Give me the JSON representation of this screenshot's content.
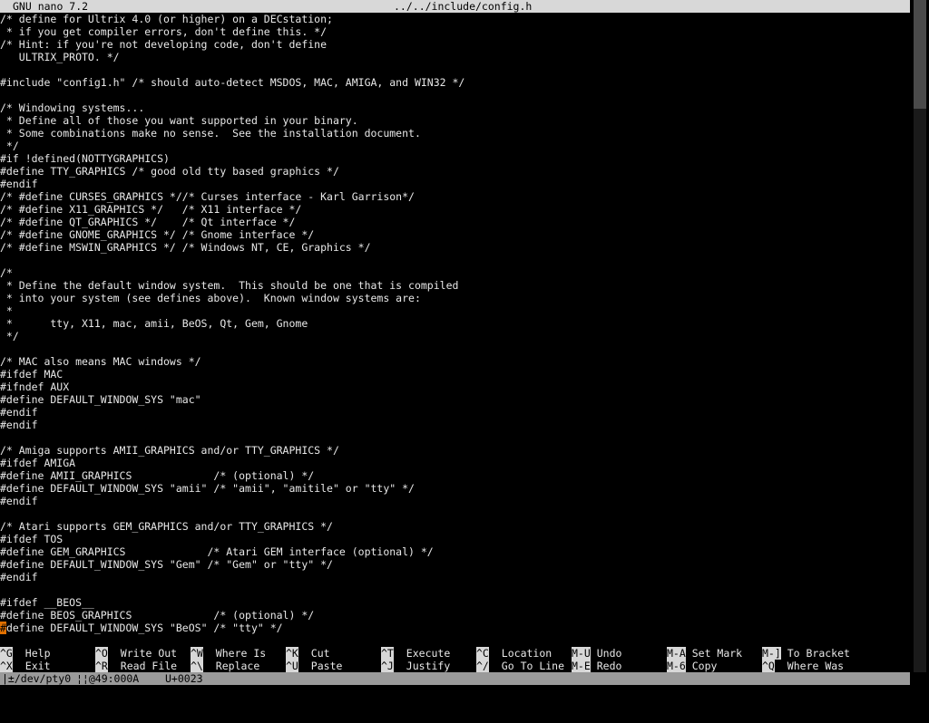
{
  "titlebar": {
    "app": "GNU nano 7.2",
    "file": "../../include/config.h"
  },
  "editor": {
    "lines": [
      "/* define for Ultrix 4.0 (or higher) on a DECstation;",
      " * if you get compiler errors, don't define this. */",
      "/* Hint: if you're not developing code, don't define",
      "   ULTRIX_PROTO. */",
      "",
      "#include \"config1.h\" /* should auto-detect MSDOS, MAC, AMIGA, and WIN32 */",
      "",
      "/* Windowing systems...",
      " * Define all of those you want supported in your binary.",
      " * Some combinations make no sense.  See the installation document.",
      " */",
      "#if !defined(NOTTYGRAPHICS)",
      "#define TTY_GRAPHICS /* good old tty based graphics */",
      "#endif",
      "/* #define CURSES_GRAPHICS *//* Curses interface - Karl Garrison*/",
      "/* #define X11_GRAPHICS */   /* X11 interface */",
      "/* #define QT_GRAPHICS */    /* Qt interface */",
      "/* #define GNOME_GRAPHICS */ /* Gnome interface */",
      "/* #define MSWIN_GRAPHICS */ /* Windows NT, CE, Graphics */",
      "",
      "/*",
      " * Define the default window system.  This should be one that is compiled",
      " * into your system (see defines above).  Known window systems are:",
      " *",
      " *      tty, X11, mac, amii, BeOS, Qt, Gem, Gnome",
      " */",
      "",
      "/* MAC also means MAC windows */",
      "#ifdef MAC",
      "#ifndef AUX",
      "#define DEFAULT_WINDOW_SYS \"mac\"",
      "#endif",
      "#endif",
      "",
      "/* Amiga supports AMII_GRAPHICS and/or TTY_GRAPHICS */",
      "#ifdef AMIGA",
      "#define AMII_GRAPHICS             /* (optional) */",
      "#define DEFAULT_WINDOW_SYS \"amii\" /* \"amii\", \"amitile\" or \"tty\" */",
      "#endif",
      "",
      "/* Atari supports GEM_GRAPHICS and/or TTY_GRAPHICS */",
      "#ifdef TOS",
      "#define GEM_GRAPHICS             /* Atari GEM interface (optional) */",
      "#define DEFAULT_WINDOW_SYS \"Gem\" /* \"Gem\" or \"tty\" */",
      "#endif",
      "",
      "#ifdef __BEOS__",
      "#define BEOS_GRAPHICS             /* (optional) */"
    ],
    "cursor_char": "#",
    "cursor_rest": "define DEFAULT_WINDOW_SYS \"BeOS\" /* \"tty\" */"
  },
  "shortcuts": [
    {
      "key": "^G",
      "label": "Help"
    },
    {
      "key": "^X",
      "label": "Exit"
    },
    {
      "key": "^O",
      "label": "Write Out"
    },
    {
      "key": "^R",
      "label": "Read File"
    },
    {
      "key": "^W",
      "label": "Where Is"
    },
    {
      "key": "^\\",
      "label": "Replace"
    },
    {
      "key": "^K",
      "label": "Cut"
    },
    {
      "key": "^U",
      "label": "Paste"
    },
    {
      "key": "^T",
      "label": "Execute"
    },
    {
      "key": "^J",
      "label": "Justify"
    },
    {
      "key": "^C",
      "label": "Location"
    },
    {
      "key": "^/",
      "label": "Go To Line"
    },
    {
      "key": "M-U",
      "label": "Undo"
    },
    {
      "key": "M-E",
      "label": "Redo"
    },
    {
      "key": "M-A",
      "label": "Set Mark"
    },
    {
      "key": "M-6",
      "label": "Copy"
    },
    {
      "key": "M-]",
      "label": "To Bracket"
    },
    {
      "key": "^Q",
      "label": "Where Was"
    }
  ],
  "statusbar": {
    "tty": "|±/dev/pty0",
    "pos": "¦¦@49:000A",
    "codepoint": "U+0023"
  },
  "colors": {
    "background": "#000000",
    "text": "#e8e8e8",
    "titlebar": "#d8d8d8",
    "cursor": "#e07000",
    "statusbar": "#9a9a9a"
  }
}
